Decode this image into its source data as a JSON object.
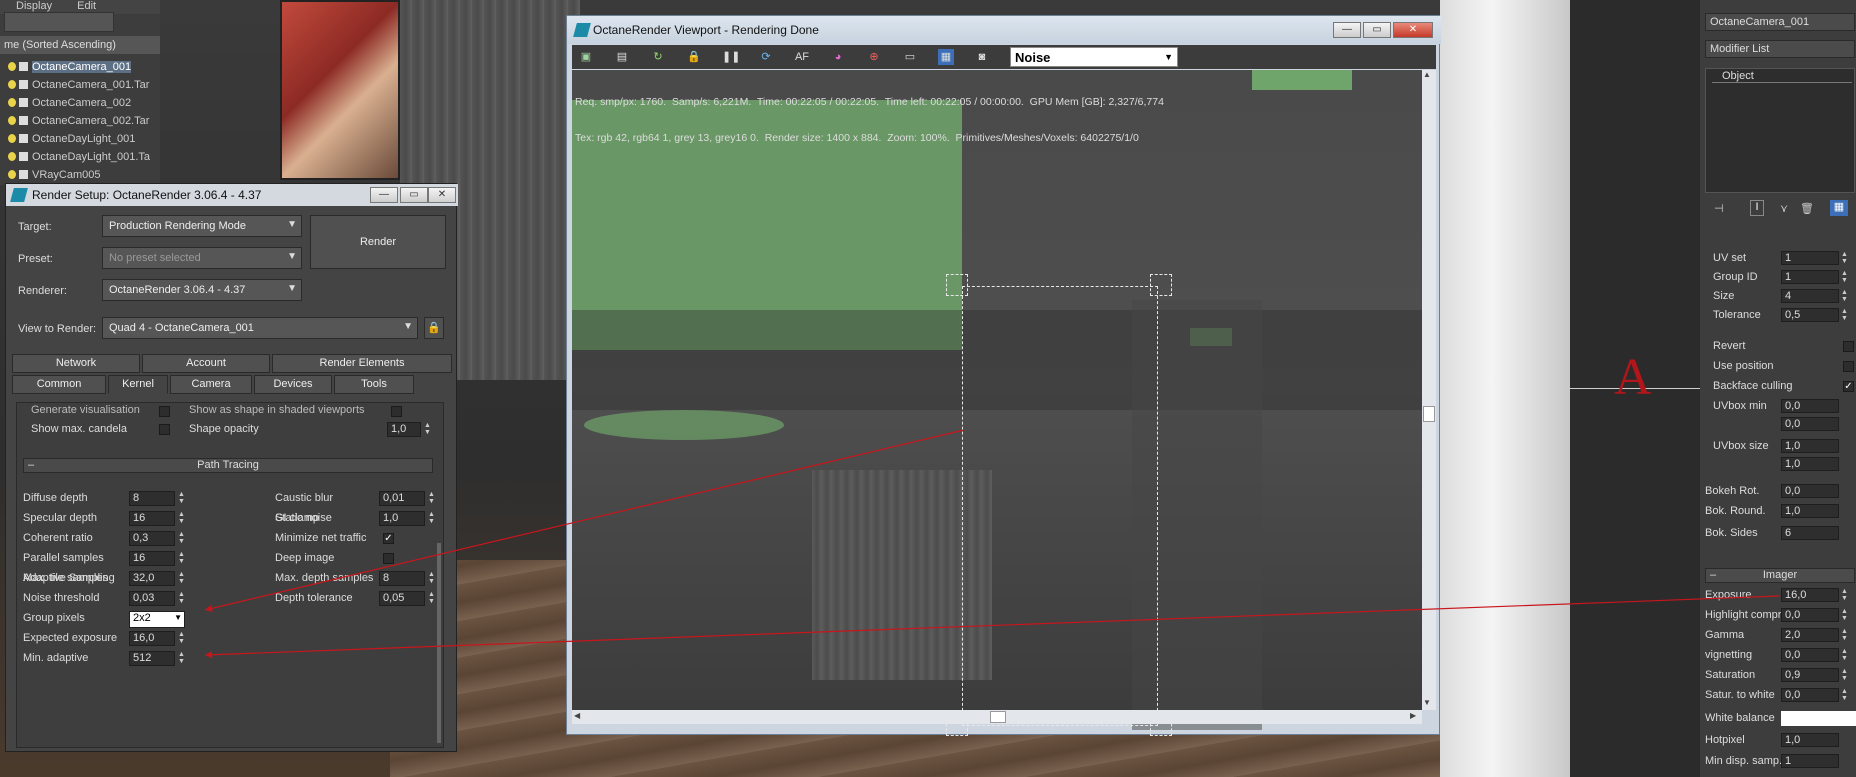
{
  "menubar": {
    "display": "Display",
    "edit": "Edit"
  },
  "explorer": {
    "header": "me (Sorted Ascending)",
    "objects": [
      {
        "name": "OctaneCamera_001",
        "selected": true
      },
      {
        "name": "OctaneCamera_001.Tar",
        "selected": false
      },
      {
        "name": "OctaneCamera_002",
        "selected": false
      },
      {
        "name": "OctaneCamera_002.Tar",
        "selected": false
      },
      {
        "name": "OctaneDayLight_001",
        "selected": false
      },
      {
        "name": "OctaneDayLight_001.Ta",
        "selected": false
      },
      {
        "name": "VRayCam005",
        "selected": false
      }
    ]
  },
  "render_setup": {
    "title": "Render Setup: OctaneRender 3.06.4 - 4.37",
    "target_label": "Target:",
    "target_value": "Production Rendering Mode",
    "preset_label": "Preset:",
    "preset_value": "No preset selected",
    "renderer_label": "Renderer:",
    "renderer_value": "OctaneRender 3.06.4 - 4.37",
    "view_label": "View to Render:",
    "view_value": "Quad 4 - OctaneCamera_001",
    "render_button": "Render",
    "tabs_top": [
      "Network",
      "Account",
      "Render Elements"
    ],
    "tabs_bottom": [
      "Common",
      "Kernel",
      "Camera",
      "Devices",
      "Tools"
    ],
    "active_tab": "Kernel",
    "prev_section": {
      "generate_vis": "Generate visualisation",
      "show_shaded": "Show as shape in shaded viewports",
      "show_candela": "Show max. candela",
      "shape_opacity_label": "Shape opacity",
      "shape_opacity": "1,0"
    },
    "section_title": "Path Tracing",
    "left_params": [
      {
        "label": "Diffuse depth",
        "value": "8"
      },
      {
        "label": "Specular depth",
        "value": "16"
      },
      {
        "label": "Coherent ratio",
        "value": "0,3"
      },
      {
        "label": "Parallel samples",
        "value": "16"
      },
      {
        "label": "Max. tile samples",
        "value": "32,0"
      }
    ],
    "adaptive_label": "Adaptive Sampling",
    "noise_label": "Noise threshold",
    "noise_value": "0,03",
    "group_label": "Group pixels",
    "group_value": "2x2",
    "expected_label": "Expected exposure",
    "expected_value": "16,0",
    "min_adaptive_label": "Min. adaptive",
    "min_adaptive_value": "512",
    "right_params": [
      {
        "label": "Caustic blur",
        "value": "0,01"
      },
      {
        "label": "GI clamp",
        "value": "1,0"
      }
    ],
    "static_noise": "Static noise",
    "min_net": "Minimize net traffic",
    "deep_image": "Deep image",
    "max_depth_label": "Max. depth samples",
    "max_depth_value": "8",
    "depth_tol_label": "Depth tolerance",
    "depth_tol_value": "0,05"
  },
  "viewport": {
    "title": "OctaneRender Viewport - Rendering Done",
    "channel": "Noise",
    "info_line1": "Req. smp/px: 1760.  Samp/s: 6,221M.  Time: 00:22:05 / 00:22:05.  Time left: 00:22:05 / 00:00:00.  GPU Mem [GB]: 2,327/6,774",
    "info_line2": "Tex: rgb 42, rgb64 1, grey 13, grey16 0.  Render size: 1400 x 884.  Zoom: 100%.  Primitives/Meshes/Voxels: 6402275/1/0"
  },
  "command_panel": {
    "object_name": "OctaneCamera_001",
    "modifier_list": "Modifier List",
    "stack_item": "Object",
    "params": [
      {
        "label": "UV set",
        "value": "1"
      },
      {
        "label": "Group ID",
        "value": "1"
      },
      {
        "label": "Size",
        "value": "4"
      },
      {
        "label": "Tolerance",
        "value": "0,5"
      }
    ],
    "revert": "Revert",
    "use_position": "Use position",
    "backface": "Backface culling",
    "uvbox_min_label": "UVbox min",
    "uvbox_min": [
      "0,0",
      "0,0"
    ],
    "uvbox_size_label": "UVbox size",
    "uvbox_size": [
      "1,0",
      "1,0"
    ],
    "bokeh_rot_label": "Bokeh Rot.",
    "bokeh_rot": "0,0",
    "bok_round_label": "Bok. Round.",
    "bok_round": "1,0",
    "bok_sides_label": "Bok. Sides",
    "bok_sides": "6",
    "imager_title": "Imager",
    "imager_params": [
      {
        "label": "Exposure",
        "value": "16,0"
      },
      {
        "label": "Highlight compr.",
        "value": "0,0"
      },
      {
        "label": "Gamma",
        "value": "2,0"
      },
      {
        "label": "vignetting",
        "value": "0,0"
      },
      {
        "label": "Saturation",
        "value": "0,9"
      },
      {
        "label": "Satur. to white",
        "value": "0,0"
      }
    ],
    "white_balance": "White balance",
    "hotpixel_label": "Hotpixel",
    "hotpixel": "1,0",
    "min_disp_label": "Min disp. samp.",
    "min_disp": "1"
  },
  "annotation_letter": "A",
  "colors": {
    "accent_arrow": "#c8161c",
    "noise_green": "#6fa46a"
  }
}
